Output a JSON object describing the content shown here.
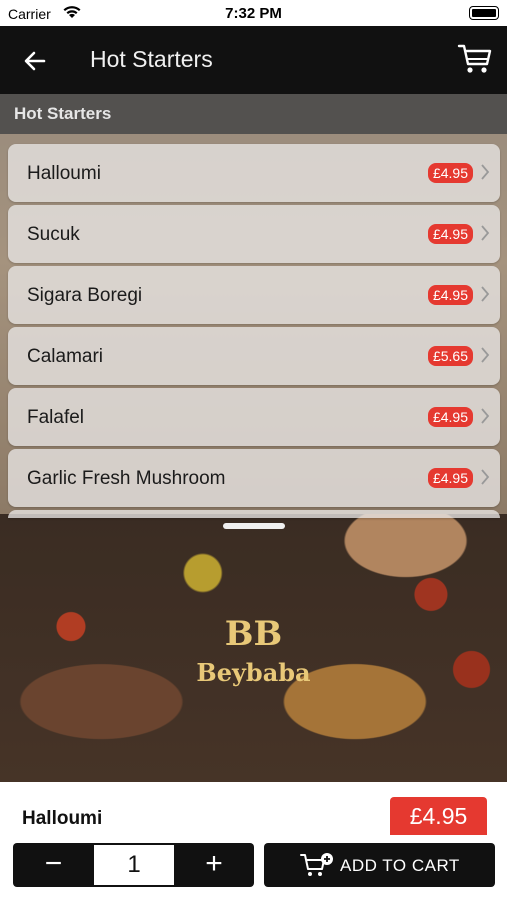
{
  "status_bar": {
    "carrier": "Carrier",
    "time": "7:32 PM"
  },
  "nav": {
    "title": "Hot Starters",
    "back_icon": "back-arrow-icon",
    "cart_icon": "cart-icon"
  },
  "section": {
    "header": "Hot Starters"
  },
  "menu_items": [
    {
      "name": "Halloumi",
      "price": "£4.95"
    },
    {
      "name": "Sucuk",
      "price": "£4.95"
    },
    {
      "name": "Sigara Boregi",
      "price": "£4.95"
    },
    {
      "name": "Calamari",
      "price": "£5.65"
    },
    {
      "name": "Falafel",
      "price": "£4.95"
    },
    {
      "name": "Garlic Fresh Mushroom",
      "price": "£4.95"
    }
  ],
  "brand": {
    "monogram": "BB",
    "name": "Beybaba"
  },
  "selected": {
    "name": "Halloumi",
    "price": "£4.95",
    "quantity": "1",
    "minus_label": "−",
    "plus_label": "+",
    "add_to_cart_label": "ADD TO CART"
  },
  "colors": {
    "accent": "#e53930",
    "nav_bg": "#111111",
    "brand_gold": "#e8c878"
  }
}
